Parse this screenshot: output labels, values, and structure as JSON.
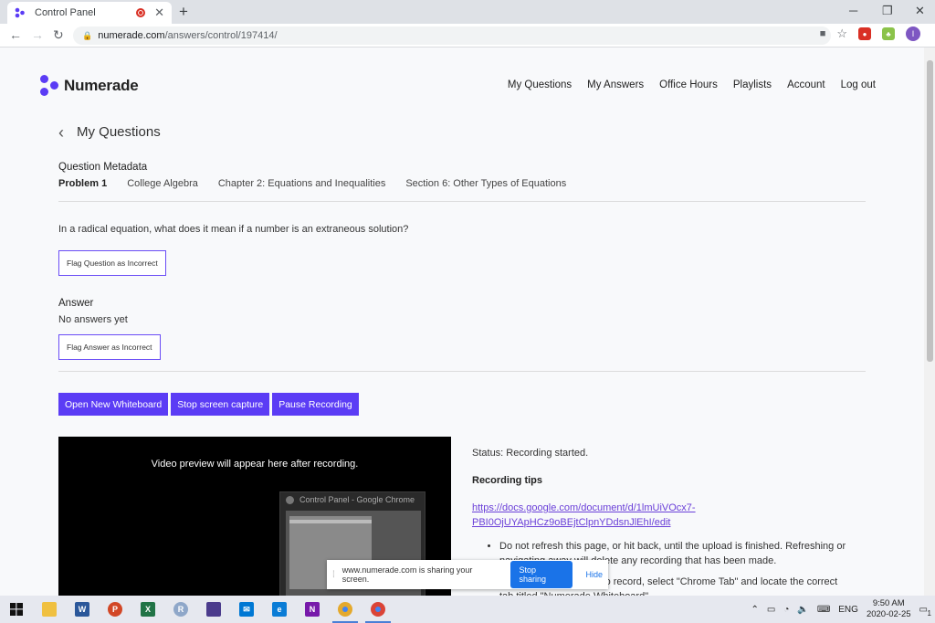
{
  "browser": {
    "tab_title": "Control Panel",
    "url_host": "numerade.com",
    "url_path": "/answers/control/197414/",
    "profile_initial": "I"
  },
  "site": {
    "brand": "Numerade",
    "nav": [
      "My Questions",
      "My Answers",
      "Office Hours",
      "Playlists",
      "Account",
      "Log out"
    ]
  },
  "page": {
    "heading": "My Questions",
    "metadata_label": "Question Metadata",
    "metadata": [
      "Problem 1",
      "College Algebra",
      "Chapter 2: Equations and Inequalities",
      "Section 6: Other Types of Equations"
    ],
    "question": "In a radical equation, what does it mean if a number is an extraneous solution?",
    "flag_question_label": "Flag Question as Incorrect",
    "answer_heading": "Answer",
    "answer_text": "No answers yet",
    "flag_answer_label": "Flag Answer as Incorrect",
    "buttons": [
      "Open New Whiteboard",
      "Stop screen capture",
      "Pause Recording"
    ],
    "video_message": "Video preview will appear here after recording.",
    "mini_window_title": "Control Panel - Google Chrome",
    "status": "Status: Recording started.",
    "tips_heading": "Recording tips",
    "tips_link": "https://docs.google.com/document/d/1lmUiVOcx7-PBI0OjUYApHCz9oBEjtClpnYDdsnJlEhI/edit",
    "tips": [
      "Do not refresh this page, or hit back, until the upload is finished. Refreshing or navigating away will delete any recording that has been made.",
      "When given the option to record, select \"Chrome Tab\" and locate the correct tab titled \"Numerade Whiteboard\"."
    ]
  },
  "share_bar": {
    "text": "www.numerade.com is sharing your screen.",
    "stop_label": "Stop sharing",
    "hide_label": "Hide"
  },
  "taskbar": {
    "language": "ENG",
    "time": "9:50 AM",
    "date": "2020-02-25",
    "notification_count": "1"
  }
}
